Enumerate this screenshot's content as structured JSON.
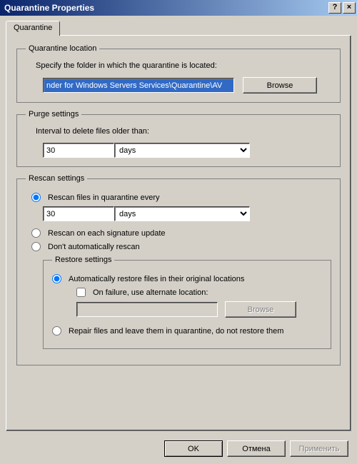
{
  "window": {
    "title": "Quarantine Properties",
    "help_icon": "?",
    "close_icon": "×"
  },
  "tab": {
    "label": "Quarantine"
  },
  "location": {
    "legend": "Quarantine location",
    "desc": "Specify the folder in which the quarantine is located:",
    "path": "nder for Windows Servers Services\\Quarantine\\AV",
    "browse": "Browse"
  },
  "purge": {
    "legend": "Purge settings",
    "desc": "Interval to delete files older than:",
    "value": "30",
    "unit": "days"
  },
  "rescan": {
    "legend": "Rescan settings",
    "opt_every": "Rescan files in quarantine every",
    "value": "30",
    "unit": "days",
    "opt_sig": "Rescan on each signature update",
    "opt_none": "Don't automatically rescan"
  },
  "restore": {
    "legend": "Restore settings",
    "opt_auto": "Automatically restore files in their original locations",
    "chk_alt": "On failure, use alternate location:",
    "alt_path": "",
    "browse": "Browse",
    "opt_repair": "Repair files and leave them in quarantine, do not restore them"
  },
  "buttons": {
    "ok": "OK",
    "cancel": "Отмена",
    "apply": "Применить"
  }
}
